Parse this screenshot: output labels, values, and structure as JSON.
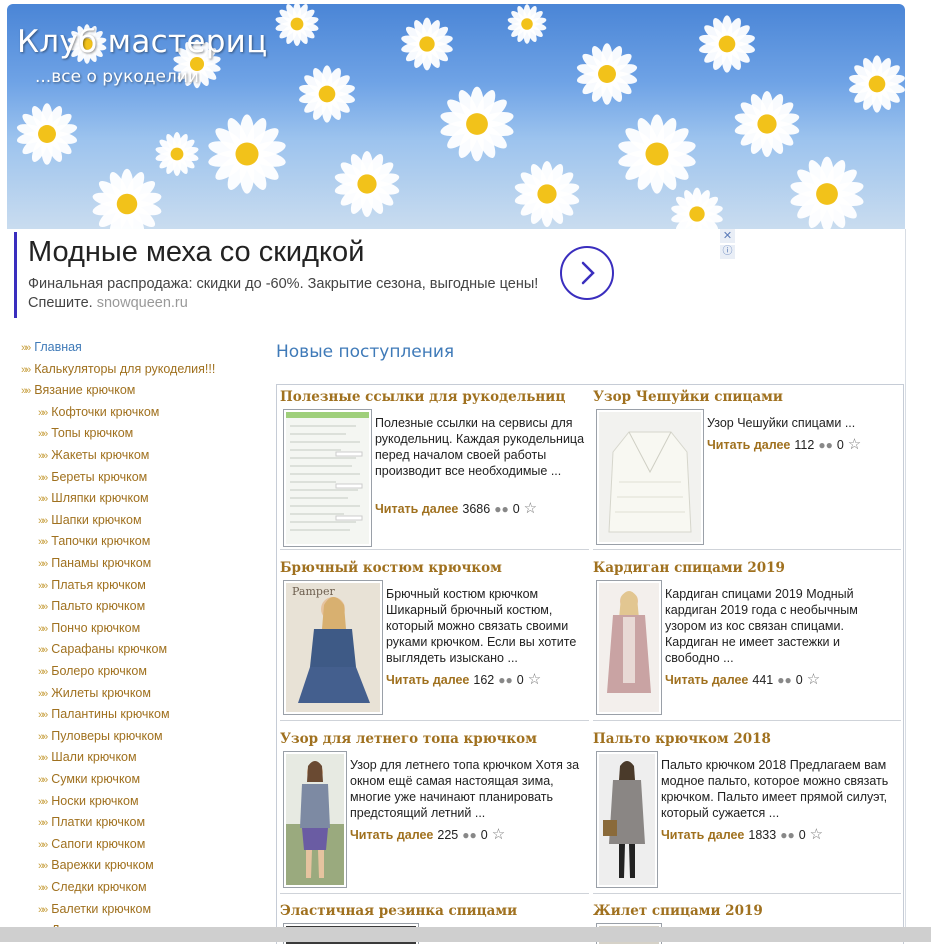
{
  "header": {
    "title": "Клуб мастериц",
    "subtitle": "...все о рукоделии"
  },
  "ad": {
    "headline": "Модные меха со скидкой",
    "text": "Финальная распродажа: скидки до -60%. Закрытие сезона, выгодные цены! Спешите.",
    "domain": "snowqueen.ru",
    "close": "✕",
    "info": "ⓘ",
    "go_icon": "chevron-right-icon"
  },
  "sidebar": {
    "items": [
      {
        "label": "Главная",
        "level": 0,
        "active": true
      },
      {
        "label": "Калькуляторы для рукоделия!!!",
        "level": 0
      },
      {
        "label": "Вязание крючком",
        "level": 0
      },
      {
        "label": "Кофточки крючком",
        "level": 1
      },
      {
        "label": "Топы крючком",
        "level": 1
      },
      {
        "label": "Жакеты крючком",
        "level": 1
      },
      {
        "label": "Береты крючком",
        "level": 1
      },
      {
        "label": "Шляпки крючком",
        "level": 1
      },
      {
        "label": "Шапки крючком",
        "level": 1
      },
      {
        "label": "Тапочки крючком",
        "level": 1
      },
      {
        "label": "Панамы крючком",
        "level": 1
      },
      {
        "label": "Платья крючком",
        "level": 1
      },
      {
        "label": "Пальто крючком",
        "level": 1
      },
      {
        "label": "Пончо крючком",
        "level": 1
      },
      {
        "label": "Сарафаны крючком",
        "level": 1
      },
      {
        "label": "Болеро крючком",
        "level": 1
      },
      {
        "label": "Жилеты крючком",
        "level": 1
      },
      {
        "label": "Палантины крючком",
        "level": 1
      },
      {
        "label": "Пуловеры крючком",
        "level": 1
      },
      {
        "label": "Шали крючком",
        "level": 1
      },
      {
        "label": "Сумки крючком",
        "level": 1
      },
      {
        "label": "Носки крючком",
        "level": 1
      },
      {
        "label": "Платки крючком",
        "level": 1
      },
      {
        "label": "Сапоги крючком",
        "level": 1
      },
      {
        "label": "Варежки крючком",
        "level": 1
      },
      {
        "label": "Следки крючком",
        "level": 1
      },
      {
        "label": "Балетки крючком",
        "level": 1
      },
      {
        "label": "Джемпера крючком",
        "level": 1
      }
    ]
  },
  "main": {
    "title": "Новые поступления",
    "read_more": "Читать далее",
    "posts": [
      {
        "title": "Полезные ссылки для рукодельниц",
        "desc": "Полезные ссылки на сервисы для рукодельниц. Каждая рукодельница перед началом своей работы производит все необходимые ...",
        "views": "3686",
        "comments": "0"
      },
      {
        "title": "Узор Чешуйки спицами",
        "desc": "Узор Чешуйки спицами ...",
        "views": "112",
        "comments": "0"
      },
      {
        "title": "Брючный костюм крючком",
        "desc": "Брючный костюм крючком Шикарный брючный костюм, который можно связать своими руками крючком. Если вы хотите выглядеть изыскано ...",
        "views": "162",
        "comments": "0"
      },
      {
        "title": "Кардиган спицами 2019",
        "desc": "Кардиган спицами 2019 Модный кардиган 2019 года с необычным узором из кос связан спицами. Кардиган не имеет застежки и свободно ...",
        "views": "441",
        "comments": "0"
      },
      {
        "title": "Узор для летнего топа крючком",
        "desc": "Узор для летнего топа крючком Хотя за окном ещё самая настоящая зима, многие уже начинают планировать предстоящий летний ...",
        "views": "225",
        "comments": "0"
      },
      {
        "title": "Пальто крючком 2018",
        "desc": "Пальто крючком 2018 Предлагаем вам модное пальто, которое можно связать крючком. Пальто имеет прямой силуэт, который сужается ...",
        "views": "1833",
        "comments": "0"
      },
      {
        "title": "Эластичная резинка спицами",
        "desc": "",
        "views": "",
        "comments": ""
      },
      {
        "title": "Жилет спицами 2019",
        "desc": "",
        "views": "",
        "comments": ""
      }
    ]
  }
}
